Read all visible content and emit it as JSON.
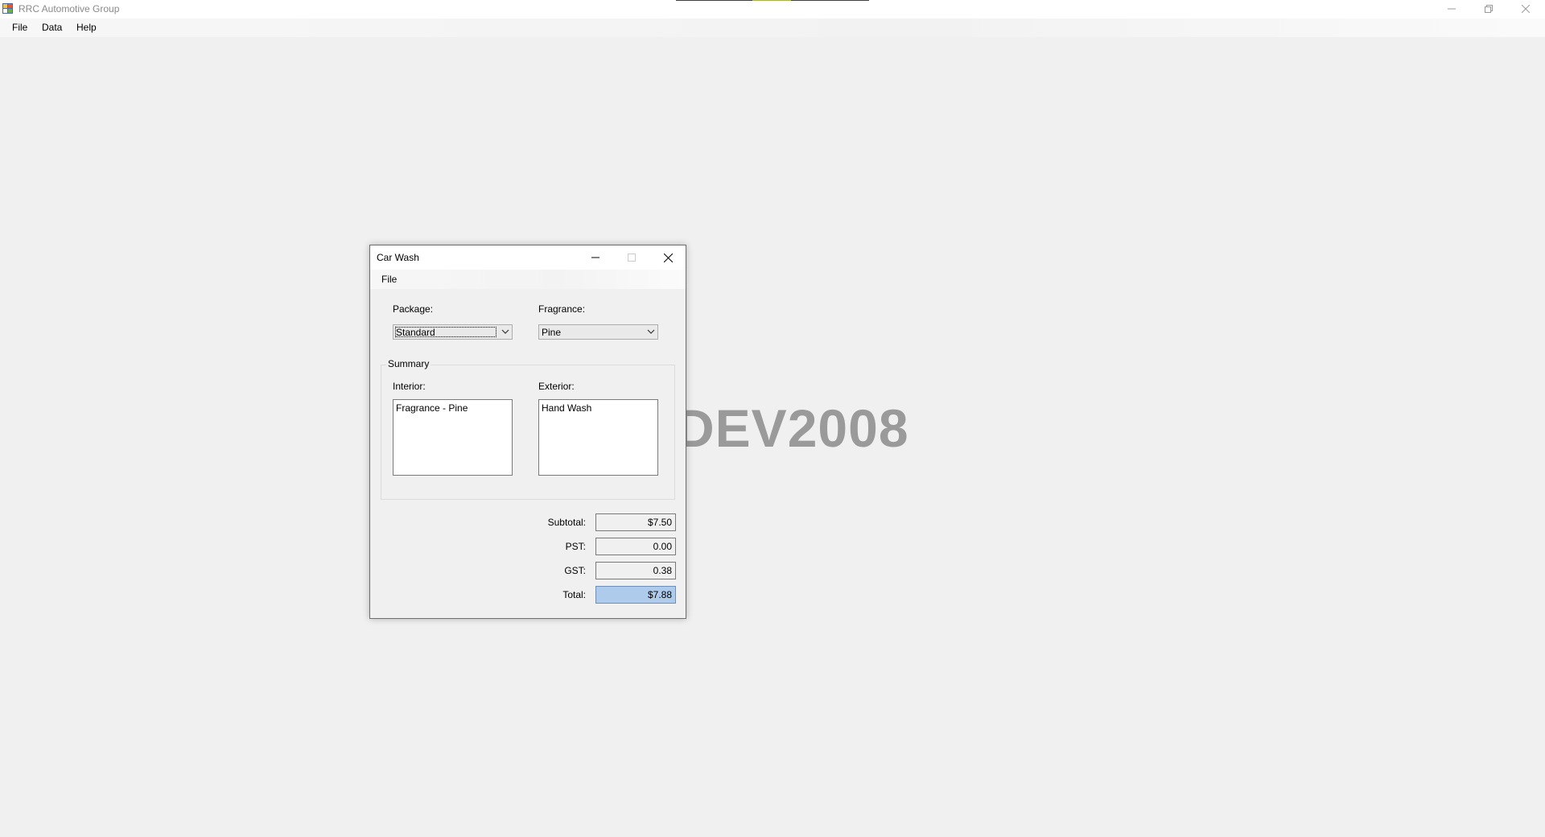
{
  "app": {
    "title": "RRC Automotive Group",
    "menu": [
      "File",
      "Data",
      "Help"
    ],
    "watermark": "DEV2008"
  },
  "dialog": {
    "title": "Car Wash",
    "menu": [
      "File"
    ],
    "package": {
      "label": "Package:",
      "value": "Standard"
    },
    "fragrance": {
      "label": "Fragrance:",
      "value": "Pine"
    },
    "summary": {
      "legend": "Summary",
      "interior": {
        "label": "Interior:",
        "items": [
          "Fragrance - Pine"
        ]
      },
      "exterior": {
        "label": "Exterior:",
        "items": [
          "Hand Wash"
        ]
      }
    },
    "totals": {
      "subtotal": {
        "label": "Subtotal:",
        "value": "$7.50"
      },
      "pst": {
        "label": "PST:",
        "value": "0.00"
      },
      "gst": {
        "label": "GST:",
        "value": "0.38"
      },
      "total": {
        "label": "Total:",
        "value": "$7.88"
      }
    }
  },
  "colors": {
    "total_highlight": "#aecbeb",
    "watermark": "#9a9a9a"
  }
}
